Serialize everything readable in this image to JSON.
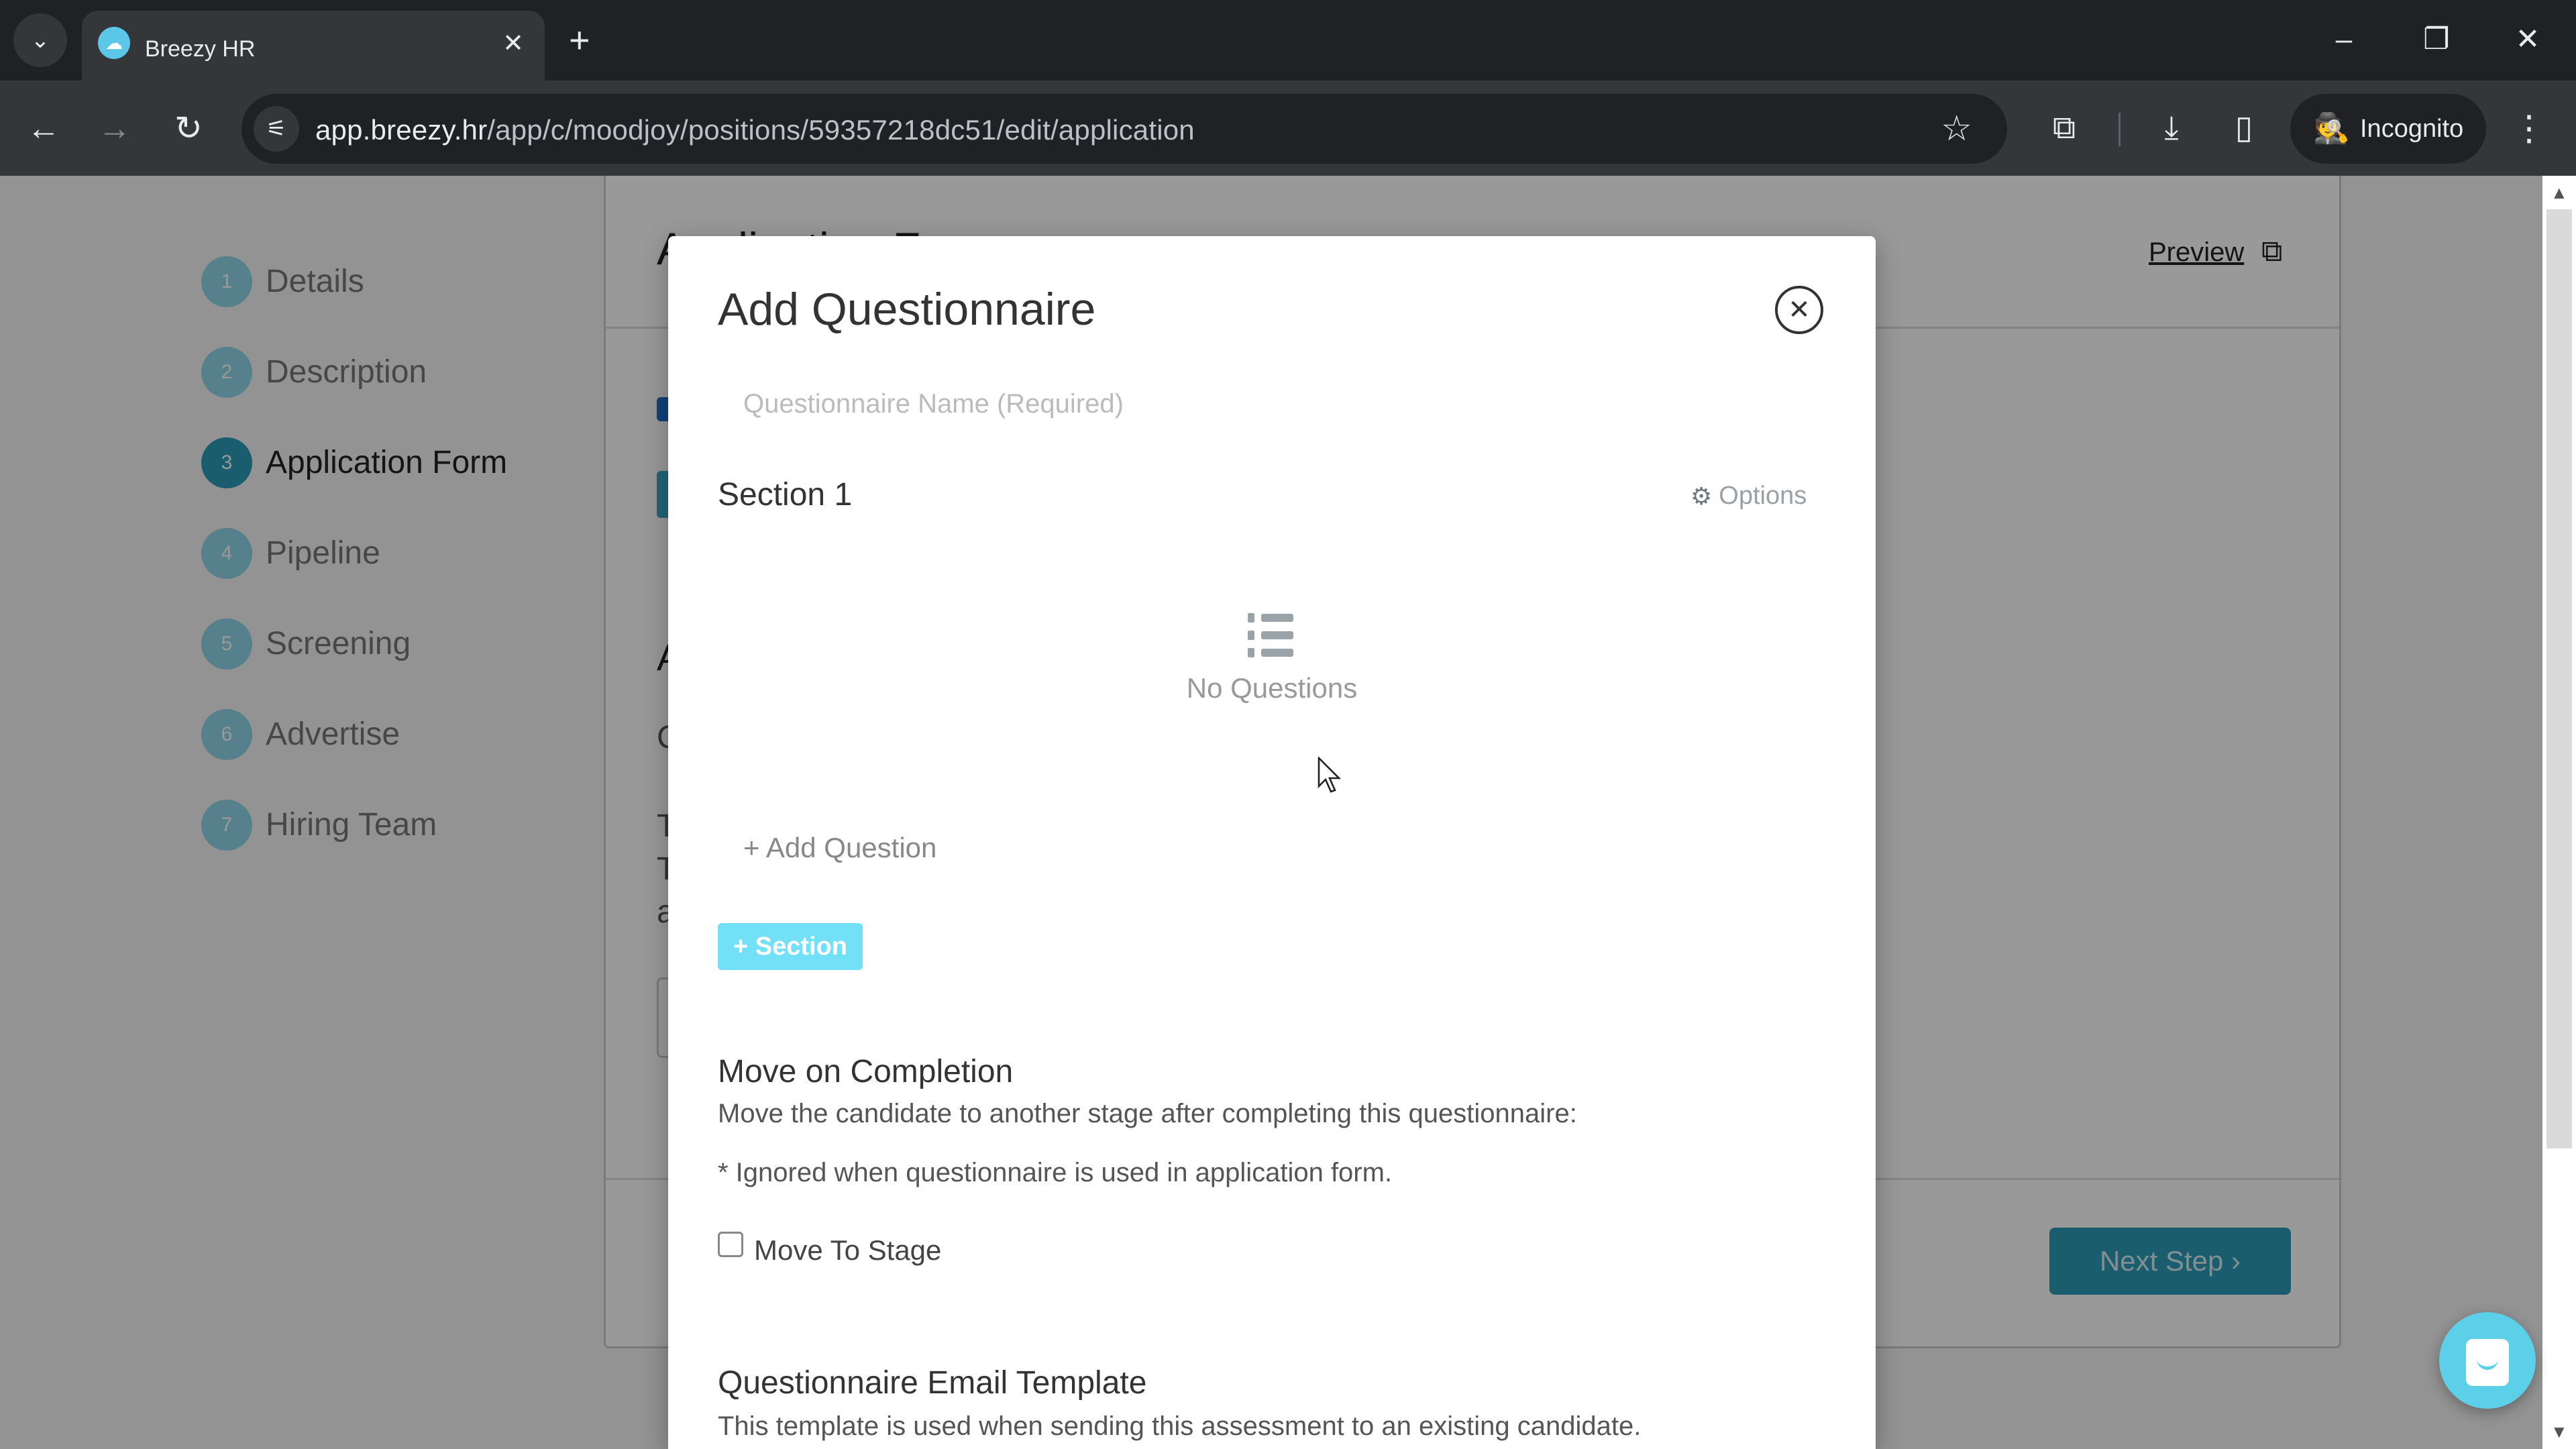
{
  "browser": {
    "tab_title": "Breezy HR",
    "tab_favicon_icon": "breezy-cloud-icon",
    "url_host": "app.breezy.hr",
    "url_path": "/app/c/moodjoy/positions/59357218dc51/edit/application",
    "incognito_label": "Incognito",
    "icons": {
      "tab_search": "⌄",
      "tab_close": "✕",
      "new_tab": "+",
      "minimize": "–",
      "restore": "❐",
      "close": "✕",
      "back": "←",
      "forward": "→",
      "reload": "↻",
      "site_info": "⚟",
      "bookmark": "☆",
      "extensions": "⧉",
      "download": "⤓",
      "side_panel": "▯",
      "incognito": "🕵",
      "menu": "⋮"
    }
  },
  "sidebar": {
    "steps": [
      {
        "number": "1",
        "label": "Details",
        "active": false
      },
      {
        "number": "2",
        "label": "Description",
        "active": false
      },
      {
        "number": "3",
        "label": "Application Form",
        "active": true
      },
      {
        "number": "4",
        "label": "Pipeline",
        "active": false
      },
      {
        "number": "5",
        "label": "Screening",
        "active": false
      },
      {
        "number": "6",
        "label": "Advertise",
        "active": false
      },
      {
        "number": "7",
        "label": "Hiring Team",
        "active": false
      }
    ]
  },
  "background_panel": {
    "title": "Application Form",
    "preview_label": "Preview",
    "section_heading_initial": "A",
    "text_initials": [
      "C",
      "T",
      "T",
      "a"
    ],
    "next_step_label": "Next Step ›"
  },
  "modal": {
    "title": "Add Questionnaire",
    "close_icon": "✕",
    "name_placeholder": "Questionnaire Name (Required)",
    "name_value": "",
    "section_title": "Section 1",
    "options_label": "Options",
    "empty_state_text": "No Questions",
    "add_question_label": "+ Add Question",
    "add_section_label": "+ Section",
    "move_on_completion": {
      "heading": "Move on Completion",
      "description": "Move the candidate to another stage after completing this questionnaire:",
      "note": "* Ignored when questionnaire is used in application form.",
      "checkbox_label": "Move To Stage",
      "checked": false
    },
    "email_template": {
      "heading": "Questionnaire Email Template",
      "description": "This template is used when sending this assessment to an existing candidate."
    }
  },
  "colors": {
    "brand_teal": "#2a9bb8",
    "section_button": "#72e0f7",
    "chat_widget": "#5ccfe9"
  }
}
